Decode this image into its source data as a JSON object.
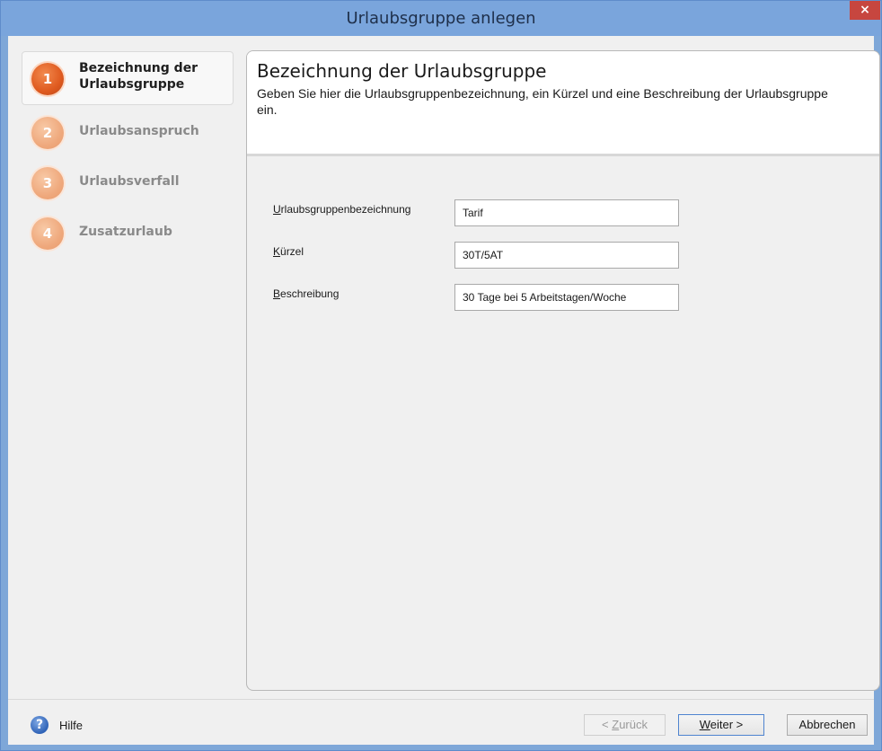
{
  "window": {
    "title": "Urlaubsgruppe anlegen",
    "close_label": "×"
  },
  "steps": [
    {
      "number": "1",
      "label": "Bezeichnung der Urlaubsgruppe",
      "state": "active"
    },
    {
      "number": "2",
      "label": "Urlaubsanspruch",
      "state": "inactive"
    },
    {
      "number": "3",
      "label": "Urlaubsverfall",
      "state": "inactive"
    },
    {
      "number": "4",
      "label": "Zusatzurlaub",
      "state": "inactive"
    }
  ],
  "header": {
    "title": "Bezeichnung der Urlaubsgruppe",
    "subtitle": "Geben Sie hier die Urlaubsgruppenbezeichnung, ein Kürzel und eine Beschreibung der Urlaubsgruppe ein."
  },
  "form": {
    "name": {
      "mnemonic": "U",
      "label_rest": "rlaubsgruppenbezeichnung",
      "value": "Tarif"
    },
    "short": {
      "mnemonic": "K",
      "label_rest": "ürzel",
      "value": "30T/5AT"
    },
    "description": {
      "mnemonic": "B",
      "label_rest": "eschreibung",
      "value": "30 Tage bei 5 Arbeitstagen/Woche"
    }
  },
  "footer": {
    "help_label": "Hilfe",
    "back": {
      "prefix": "< ",
      "mnemonic": "Z",
      "rest": "urück"
    },
    "next": {
      "mnemonic": "W",
      "rest": "eiter",
      "suffix": " >"
    },
    "cancel_label": "Abbrechen"
  },
  "colors": {
    "titlebar": "#7aa5dc",
    "close": "#c7463f",
    "step_active": "#df5a1f",
    "step_inactive": "#efa97d",
    "help_icon": "#2f63b7"
  }
}
